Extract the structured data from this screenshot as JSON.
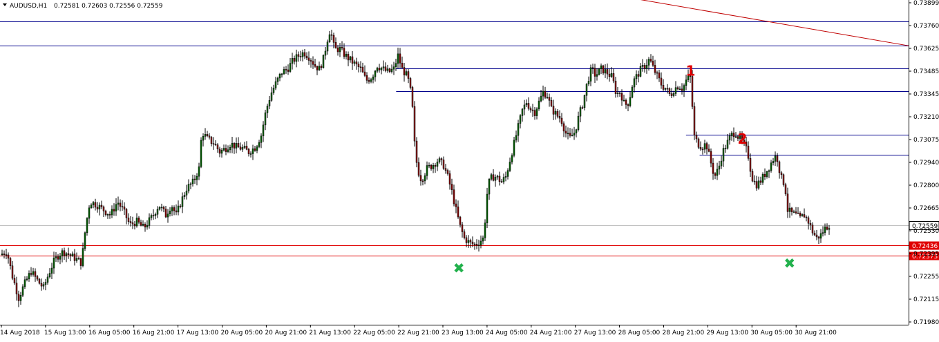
{
  "header": {
    "symbol": "AUDUSD,H1",
    "ohlc": "0.72581 0.72603 0.72556 0.72559"
  },
  "chart_data": {
    "type": "candlestick",
    "symbol": "AUDUSD",
    "timeframe": "H1",
    "ylim": [
      0.71975,
      0.73899
    ],
    "y_ticks": [
      "0.73899",
      "0.73760",
      "0.73625",
      "0.73485",
      "0.73345",
      "0.73210",
      "0.73075",
      "0.72940",
      "0.72800",
      "0.72665",
      "0.72530",
      "0.72395",
      "0.72255",
      "0.72115",
      "0.71980"
    ],
    "x_ticks": [
      "14 Aug 2018",
      "15 Aug 13:00",
      "16 Aug 05:00",
      "16 Aug 21:00",
      "17 Aug 13:00",
      "20 Aug 05:00",
      "20 Aug 21:00",
      "21 Aug 13:00",
      "22 Aug 05:00",
      "22 Aug 21:00",
      "23 Aug 13:00",
      "24 Aug 05:00",
      "24 Aug 21:00",
      "27 Aug 13:00",
      "28 Aug 05:00",
      "28 Aug 21:00",
      "29 Aug 13:00",
      "30 Aug 05:00",
      "30 Aug 21:00"
    ],
    "bull_color": "#006400",
    "bear_color": "#8b0000",
    "current_price": {
      "value": 0.72559,
      "label": "0.72559",
      "color": "#c0c0c0"
    },
    "horizontal_lines": [
      {
        "price": 0.73785,
        "color": "#00008b",
        "x_start": 0
      },
      {
        "price": 0.7364,
        "color": "#00008b",
        "x_start": 0
      },
      {
        "price": 0.73503,
        "color": "#00008b",
        "x_start": 0.436
      },
      {
        "price": 0.73366,
        "color": "#00008b",
        "x_start": 0.436
      },
      {
        "price": 0.73105,
        "color": "#00008b",
        "x_start": 0.755
      },
      {
        "price": 0.72983,
        "color": "#00008b",
        "x_start": 0.77
      },
      {
        "price": 0.72436,
        "color": "#e00000",
        "x_start": 0,
        "label": "0.72436"
      },
      {
        "price": 0.72373,
        "color": "#e00000",
        "x_start": 0,
        "label": "0.72373"
      }
    ],
    "trend_line": {
      "color": "#c00000",
      "from": [
        0.66,
        0.7396
      ],
      "to": [
        1.0,
        0.7364
      ]
    },
    "annotations": [
      {
        "text": "1",
        "color": "#e00000",
        "x": 0.76,
        "price": 0.7346
      },
      {
        "text": "2",
        "color": "#e00000",
        "x": 0.817,
        "price": 0.7305
      },
      {
        "text": "✖",
        "color": "#22b14c",
        "x": 0.505,
        "price": 0.7227
      },
      {
        "text": "✖",
        "color": "#22b14c",
        "x": 0.869,
        "price": 0.723
      }
    ],
    "anchors": [
      [
        0,
        0.7238
      ],
      [
        10,
        0.724
      ],
      [
        18,
        0.7225
      ],
      [
        27,
        0.7212
      ],
      [
        35,
        0.722
      ],
      [
        45,
        0.7228
      ],
      [
        55,
        0.7222
      ],
      [
        63,
        0.7218
      ],
      [
        70,
        0.7226
      ],
      [
        78,
        0.7234
      ],
      [
        85,
        0.7238
      ],
      [
        92,
        0.724
      ],
      [
        100,
        0.7238
      ],
      [
        108,
        0.7236
      ],
      [
        118,
        0.7233
      ],
      [
        124,
        0.7255
      ],
      [
        130,
        0.727
      ],
      [
        140,
        0.7268
      ],
      [
        150,
        0.7265
      ],
      [
        160,
        0.7262
      ],
      [
        170,
        0.727
      ],
      [
        178,
        0.7265
      ],
      [
        188,
        0.7256
      ],
      [
        198,
        0.7258
      ],
      [
        208,
        0.7254
      ],
      [
        215,
        0.7258
      ],
      [
        222,
        0.7262
      ],
      [
        230,
        0.7268
      ],
      [
        240,
        0.7262
      ],
      [
        248,
        0.7268
      ],
      [
        255,
        0.7262
      ],
      [
        262,
        0.727
      ],
      [
        270,
        0.7278
      ],
      [
        280,
        0.7282
      ],
      [
        288,
        0.729
      ],
      [
        292,
        0.7312
      ],
      [
        300,
        0.7308
      ],
      [
        310,
        0.7305
      ],
      [
        318,
        0.73
      ],
      [
        326,
        0.7302
      ],
      [
        334,
        0.7305
      ],
      [
        342,
        0.7303
      ],
      [
        352,
        0.7302
      ],
      [
        360,
        0.73
      ],
      [
        370,
        0.7303
      ],
      [
        378,
        0.731
      ],
      [
        385,
        0.7325
      ],
      [
        392,
        0.7335
      ],
      [
        400,
        0.7342
      ],
      [
        408,
        0.7348
      ],
      [
        416,
        0.735
      ],
      [
        424,
        0.7355
      ],
      [
        432,
        0.7358
      ],
      [
        440,
        0.736
      ],
      [
        448,
        0.7357
      ],
      [
        456,
        0.7352
      ],
      [
        462,
        0.735
      ],
      [
        468,
        0.7356
      ],
      [
        474,
        0.7368
      ],
      [
        478,
        0.7374
      ],
      [
        484,
        0.7362
      ],
      [
        492,
        0.7362
      ],
      [
        500,
        0.7358
      ],
      [
        508,
        0.7355
      ],
      [
        516,
        0.7352
      ],
      [
        522,
        0.735
      ],
      [
        530,
        0.7343
      ],
      [
        538,
        0.7345
      ],
      [
        546,
        0.7352
      ],
      [
        554,
        0.735
      ],
      [
        562,
        0.7348
      ],
      [
        570,
        0.735
      ],
      [
        576,
        0.7358
      ],
      [
        582,
        0.735
      ],
      [
        590,
        0.7345
      ],
      [
        596,
        0.7333
      ],
      [
        600,
        0.7305
      ],
      [
        604,
        0.729
      ],
      [
        610,
        0.7283
      ],
      [
        618,
        0.729
      ],
      [
        626,
        0.7292
      ],
      [
        634,
        0.7295
      ],
      [
        642,
        0.7292
      ],
      [
        648,
        0.7285
      ],
      [
        654,
        0.7276
      ],
      [
        660,
        0.7265
      ],
      [
        666,
        0.7255
      ],
      [
        672,
        0.7248
      ],
      [
        680,
        0.7245
      ],
      [
        688,
        0.7244
      ],
      [
        694,
        0.7246
      ],
      [
        700,
        0.7248
      ],
      [
        706,
        0.728
      ],
      [
        712,
        0.7285
      ],
      [
        718,
        0.7285
      ],
      [
        726,
        0.7282
      ],
      [
        732,
        0.7285
      ],
      [
        738,
        0.7295
      ],
      [
        744,
        0.7305
      ],
      [
        750,
        0.7315
      ],
      [
        756,
        0.7325
      ],
      [
        762,
        0.733
      ],
      [
        768,
        0.7326
      ],
      [
        774,
        0.7324
      ],
      [
        780,
        0.733
      ],
      [
        786,
        0.7336
      ],
      [
        792,
        0.7334
      ],
      [
        798,
        0.7326
      ],
      [
        806,
        0.7322
      ],
      [
        812,
        0.732
      ],
      [
        818,
        0.7312
      ],
      [
        824,
        0.7308
      ],
      [
        832,
        0.7312
      ],
      [
        838,
        0.7322
      ],
      [
        844,
        0.733
      ],
      [
        850,
        0.7342
      ],
      [
        856,
        0.735
      ],
      [
        862,
        0.7346
      ],
      [
        870,
        0.735
      ],
      [
        878,
        0.7348
      ],
      [
        886,
        0.7345
      ],
      [
        892,
        0.7335
      ],
      [
        898,
        0.7336
      ],
      [
        904,
        0.7328
      ],
      [
        910,
        0.733
      ],
      [
        916,
        0.7342
      ],
      [
        922,
        0.7346
      ],
      [
        928,
        0.735
      ],
      [
        934,
        0.7352
      ],
      [
        940,
        0.7356
      ],
      [
        946,
        0.735
      ],
      [
        952,
        0.7345
      ],
      [
        958,
        0.734
      ],
      [
        964,
        0.7338
      ],
      [
        970,
        0.7334
      ],
      [
        976,
        0.7338
      ],
      [
        982,
        0.734
      ],
      [
        988,
        0.7338
      ],
      [
        994,
        0.7344
      ],
      [
        1000,
        0.7345
      ],
      [
        1004,
        0.731
      ],
      [
        1010,
        0.7305
      ],
      [
        1016,
        0.7303
      ],
      [
        1022,
        0.7305
      ],
      [
        1028,
        0.7295
      ],
      [
        1034,
        0.7285
      ],
      [
        1040,
        0.729
      ],
      [
        1046,
        0.73
      ],
      [
        1052,
        0.7305
      ],
      [
        1058,
        0.731
      ],
      [
        1064,
        0.7312
      ],
      [
        1070,
        0.7308
      ],
      [
        1076,
        0.7305
      ],
      [
        1082,
        0.73
      ],
      [
        1088,
        0.7285
      ],
      [
        1094,
        0.728
      ],
      [
        1100,
        0.7282
      ],
      [
        1106,
        0.7286
      ],
      [
        1112,
        0.729
      ],
      [
        1118,
        0.7295
      ],
      [
        1124,
        0.7298
      ],
      [
        1130,
        0.7285
      ],
      [
        1136,
        0.728
      ],
      [
        1140,
        0.7265
      ],
      [
        1146,
        0.7263
      ],
      [
        1152,
        0.7262
      ],
      [
        1158,
        0.726
      ],
      [
        1164,
        0.7262
      ],
      [
        1170,
        0.7258
      ],
      [
        1176,
        0.7252
      ],
      [
        1182,
        0.7248
      ],
      [
        1188,
        0.725
      ],
      [
        1194,
        0.7254
      ],
      [
        1200,
        0.7256
      ]
    ]
  }
}
